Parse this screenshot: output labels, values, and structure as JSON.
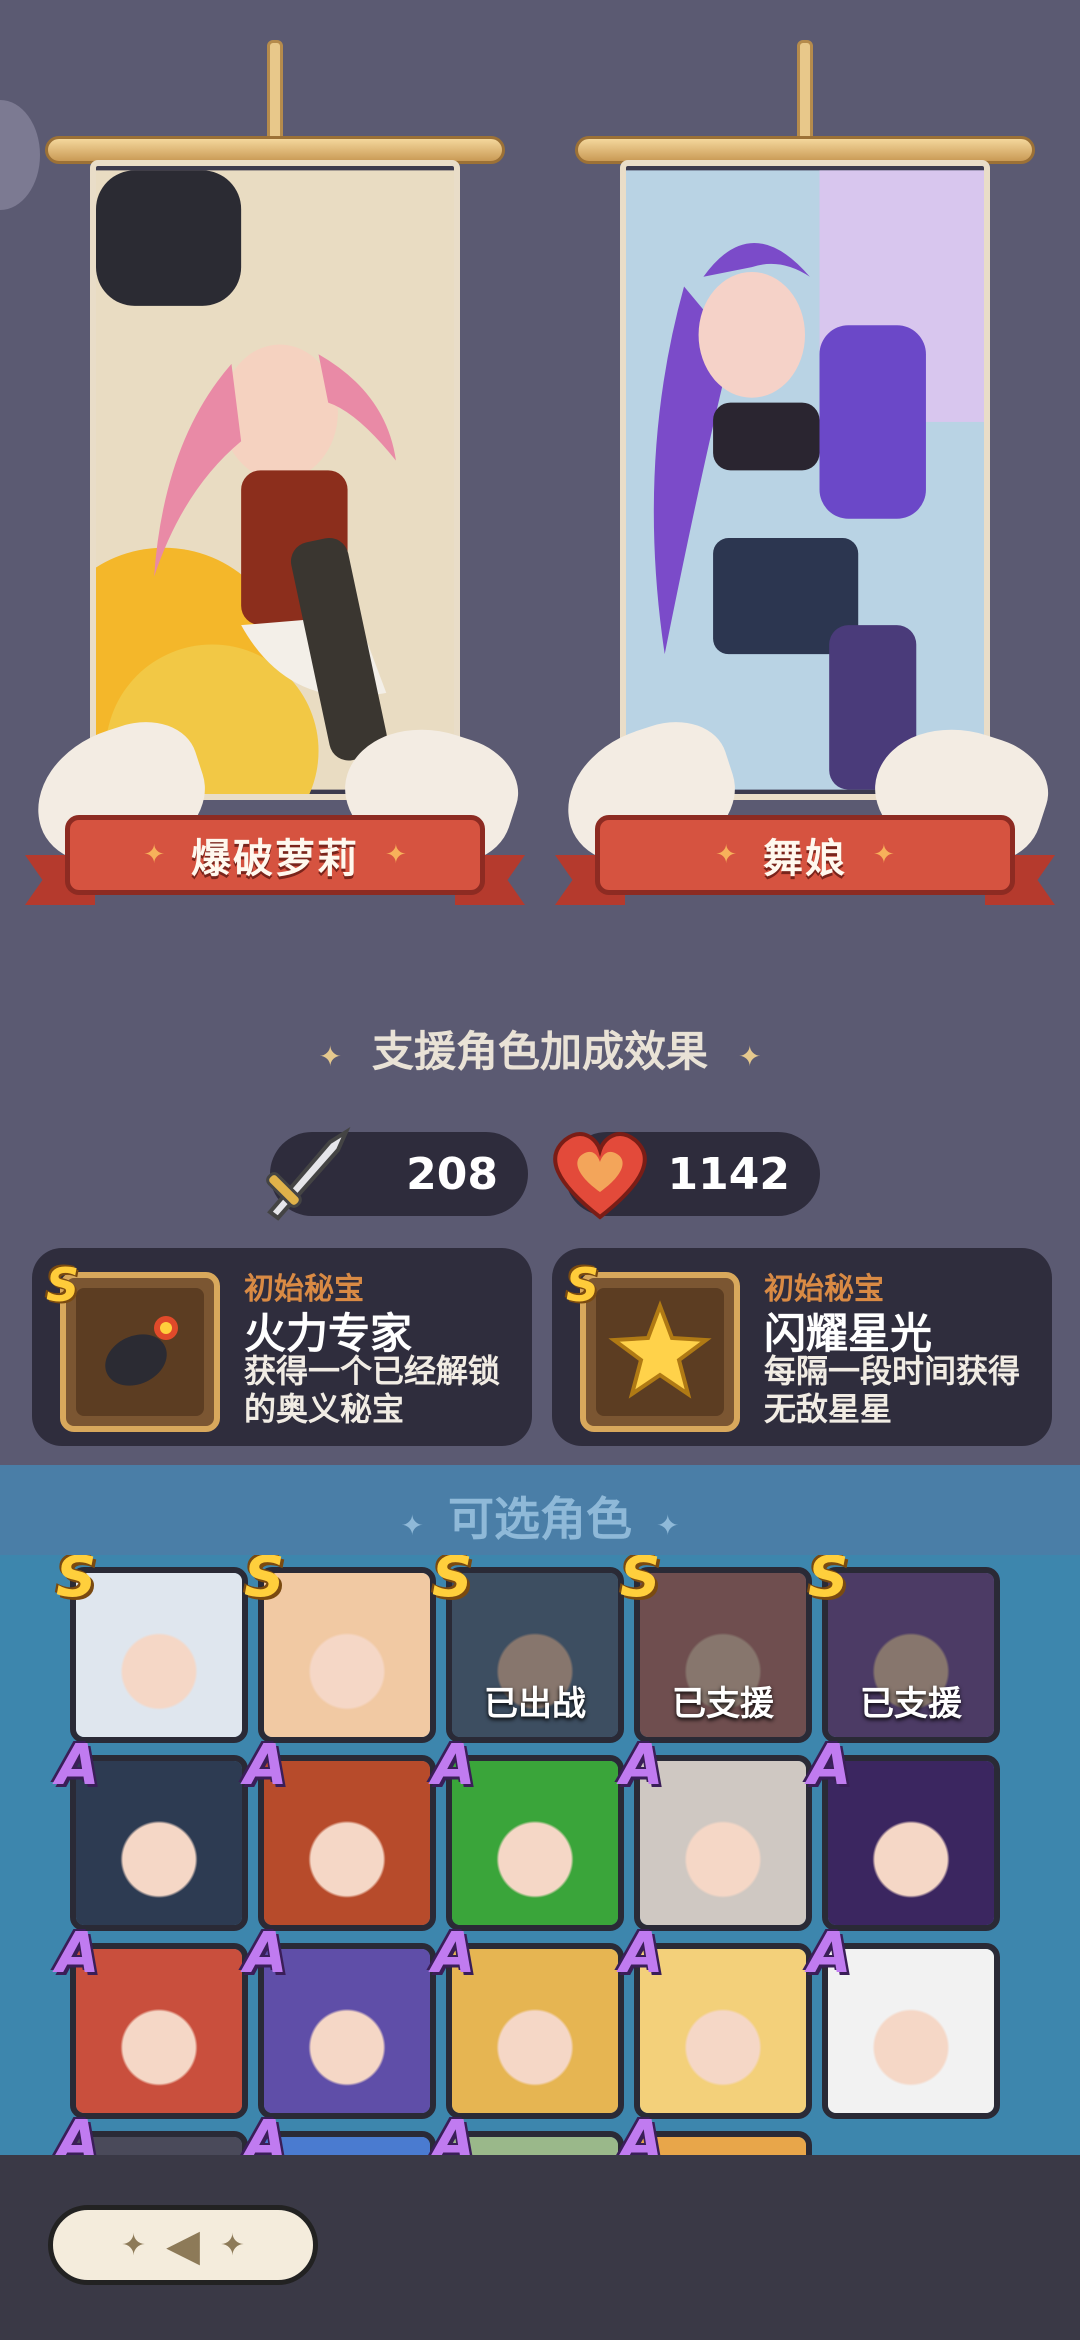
{
  "banners": [
    {
      "name": "爆破萝莉",
      "colors": {
        "bg": "#f2c845",
        "hair": "#e98aa6",
        "dress": "#8c2e1c"
      }
    },
    {
      "name": "舞娘",
      "colors": {
        "bg": "#b9d3e4",
        "hair": "#7b4bc9",
        "top": "#2a2530"
      }
    }
  ],
  "support_section": {
    "title": "支援角色加成效果"
  },
  "stats": {
    "attack": "208",
    "health": "1142",
    "attack_icon": "sword-icon",
    "health_icon": "heart-icon"
  },
  "relics": [
    {
      "rank": "S",
      "subtitle": "初始秘宝",
      "title": "火力专家",
      "desc": "获得一个已经解锁的奥义秘宝",
      "icon": "bomb-icon"
    },
    {
      "rank": "S",
      "subtitle": "初始秘宝",
      "title": "闪耀星光",
      "desc": "每隔一段时间获得无敌星星",
      "icon": "star-icon"
    }
  ],
  "selectable": {
    "title": "可选角色",
    "rows": [
      [
        {
          "rank": "S",
          "status": "",
          "color": "#dfe6ee"
        },
        {
          "rank": "S",
          "status": "",
          "color": "#f1c9a3"
        },
        {
          "rank": "S",
          "status": "已出战",
          "color": "#6f8db0"
        },
        {
          "rank": "S",
          "status": "已支援",
          "color": "#c98d8f"
        },
        {
          "rank": "S",
          "status": "已支援",
          "color": "#8b6cb8"
        }
      ],
      [
        {
          "rank": "A",
          "status": "",
          "color": "#2d3b52"
        },
        {
          "rank": "A",
          "status": "",
          "color": "#b74b2b"
        },
        {
          "rank": "A",
          "status": "",
          "color": "#3aa53a"
        },
        {
          "rank": "A",
          "status": "",
          "color": "#cfc8c2"
        },
        {
          "rank": "A",
          "status": "",
          "color": "#3b2660"
        }
      ],
      [
        {
          "rank": "A",
          "status": "",
          "color": "#c94f3d"
        },
        {
          "rank": "A",
          "status": "",
          "color": "#5f4ea8"
        },
        {
          "rank": "A",
          "status": "",
          "color": "#e6b552"
        },
        {
          "rank": "A",
          "status": "",
          "color": "#f3d07a"
        },
        {
          "rank": "A",
          "status": "",
          "color": "#f2f2f2"
        }
      ],
      [
        {
          "rank": "A",
          "status": "",
          "color": "#4a4a5a"
        },
        {
          "rank": "A",
          "status": "",
          "color": "#4a7bd0"
        },
        {
          "rank": "A",
          "status": "",
          "color": "#9ab88a"
        },
        {
          "rank": "A",
          "status": "",
          "color": "#e8a64a"
        }
      ]
    ]
  },
  "back_button": {
    "icon": "back-arrow-icon"
  }
}
